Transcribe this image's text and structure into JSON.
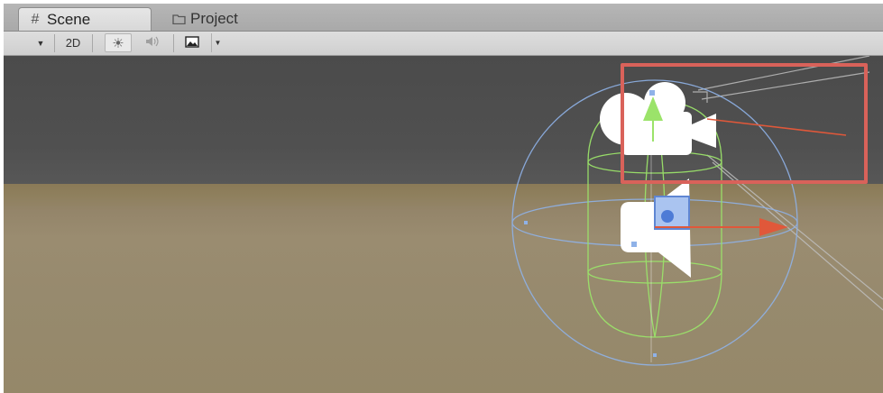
{
  "tabs": [
    {
      "label": "Scene",
      "icon": "hash-icon",
      "active": true
    },
    {
      "label": "Project",
      "icon": "folder-icon",
      "active": false
    }
  ],
  "toolbar": {
    "mode_2d_label": "2D",
    "lighting_icon": "sun-icon",
    "audio_icon": "speaker-icon",
    "effects_icon": "image-icon"
  },
  "colors": {
    "highlight": "#d9625a",
    "sky": "#4e4e4e",
    "ground": "#958869",
    "gizmo_green": "#9be36a",
    "gizmo_blue": "#8fb2e8",
    "gizmo_red": "#e0583a"
  }
}
